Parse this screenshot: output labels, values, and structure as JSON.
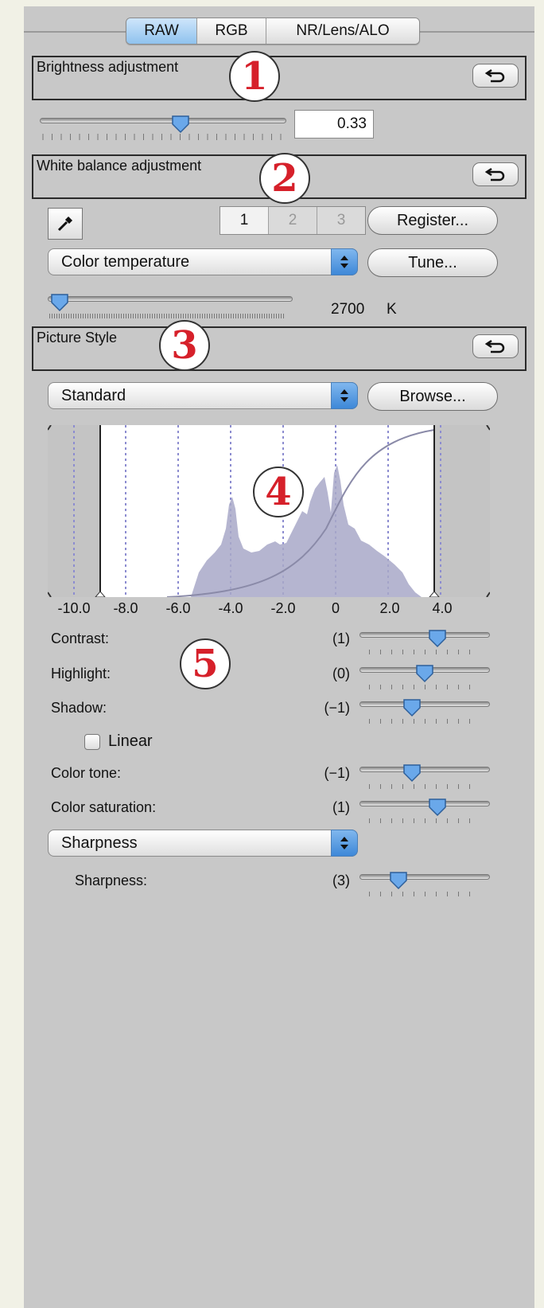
{
  "tabs": [
    {
      "label": "RAW",
      "active": true
    },
    {
      "label": "RGB",
      "active": false
    },
    {
      "label": "NR/Lens/ALO",
      "active": false
    }
  ],
  "brightness": {
    "title": "Brightness adjustment",
    "badge": "1",
    "value": "0.33",
    "slider_fraction": 0.57
  },
  "white_balance": {
    "title": "White balance adjustment",
    "badge": "2",
    "presets": [
      "1",
      "2",
      "3"
    ],
    "register_label": "Register...",
    "mode": "Color temperature",
    "tune_label": "Tune...",
    "temperature": "2700",
    "unit": "K",
    "slider_fraction": 0.05
  },
  "picture_style": {
    "title": "Picture Style",
    "badge": "3",
    "style": "Standard",
    "browse_label": "Browse..."
  },
  "histogram": {
    "badge": "4",
    "axis_labels": [
      "-10.0",
      "-8.0",
      "-6.0",
      "-4.0",
      "-2.0",
      "0",
      "2.0",
      "4.0"
    ],
    "clip_low": -8.0,
    "clip_high": 3.8
  },
  "adjustments": {
    "badge": "5",
    "rows": [
      {
        "label": "Contrast:",
        "value": "(1)",
        "fraction": 0.6
      },
      {
        "label": "Highlight:",
        "value": "(0)",
        "fraction": 0.5
      },
      {
        "label": "Shadow:",
        "value": "(−1)",
        "fraction": 0.4
      }
    ],
    "linear_label": "Linear",
    "rows2": [
      {
        "label": "Color tone:",
        "value": "(−1)",
        "fraction": 0.4
      },
      {
        "label": "Color saturation:",
        "value": "(1)",
        "fraction": 0.6
      }
    ],
    "sharpness_mode": "Sharpness",
    "sharpness": {
      "label": "Sharpness:",
      "value": "(3)",
      "fraction": 0.3
    }
  },
  "colors": {
    "panel": "#c8c8c8",
    "background": "#f1f1e6",
    "badge_number": "#d6202a",
    "active_tab": "#8fc2ee",
    "histogram_fill": "#a8a8c8"
  }
}
